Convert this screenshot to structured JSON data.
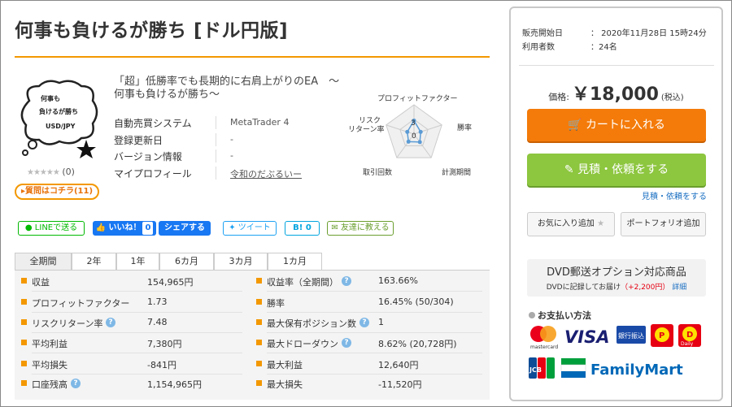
{
  "product": {
    "title": "何事も負けるが勝ち [ドル円版]",
    "cloud_lines": [
      "何事も",
      "負けるが勝ち",
      "USD/JPY"
    ],
    "rating_stars": "★★★★★",
    "rating_count": "(0)",
    "qa_button": "▸質問はコチラ(11)",
    "description": "「超」低勝率でも長期的に右肩上がりのEA　～何事も負けるが勝ち～",
    "properties": [
      {
        "label": "自動売買システム",
        "value": "MetaTrader 4"
      },
      {
        "label": "登録更新日",
        "value": "-"
      },
      {
        "label": "バージョン情報",
        "value": "-"
      },
      {
        "label": "マイプロフィール",
        "value": "令和のだぶるいー"
      }
    ]
  },
  "radar": {
    "labels": [
      "プロフィットファクター",
      "勝率",
      "計測期間",
      "取引回数",
      "リスクリターン率"
    ],
    "scale_labels": [
      "3",
      "0"
    ],
    "values": [
      2.3,
      1.2,
      1.7,
      1.6,
      1.2
    ],
    "max": 5
  },
  "social": {
    "line": "LINEで送る",
    "like": "いいね！",
    "like_count": "0",
    "share": "シェアする",
    "tweet": "ツイート",
    "hatena": "B!",
    "hatena_count": "0",
    "friend": "友達に教える"
  },
  "tabs": [
    "全期間",
    "2年",
    "1年",
    "6カ月",
    "3カ月",
    "1カ月"
  ],
  "stats_left": [
    {
      "label": "収益",
      "value": "154,965円",
      "help": false
    },
    {
      "label": "プロフィットファクター",
      "value": "1.73",
      "help": false
    },
    {
      "label": "リスクリターン率",
      "value": "7.48",
      "help": true
    },
    {
      "label": "平均利益",
      "value": "7,380円",
      "help": false
    },
    {
      "label": "平均損失",
      "value": "-841円",
      "help": false
    },
    {
      "label": "口座残高",
      "value": "1,154,965円",
      "help": true
    }
  ],
  "stats_right": [
    {
      "label": "収益率（全期間）",
      "value": "163.66%",
      "help": true
    },
    {
      "label": "勝率",
      "value": "16.45% (50/304)",
      "help": false
    },
    {
      "label": "最大保有ポジション数",
      "value": "1",
      "help": true
    },
    {
      "label": "最大ドローダウン",
      "value": "8.62% (20,728円)",
      "help": true
    },
    {
      "label": "最大利益",
      "value": "12,640円",
      "help": false
    },
    {
      "label": "最大損失",
      "value": "-11,520円",
      "help": false
    }
  ],
  "sidebar": {
    "sale_start_label": "販売開始日",
    "sale_start_value": "：  2020年11月28日 15時24分",
    "users_label": "利用者数",
    "users_value": "：24名",
    "price_label": "価格:",
    "price_value": "￥18,000",
    "price_tax": "(税込)",
    "cart_button": "カートに入れる",
    "quote_button": "見積・依頼をする",
    "quote_link": "見積・依頼をする",
    "fav_button": "お気に入り追加",
    "portfolio_button": "ポートフォリオ追加",
    "dvd_title": "DVD郵送オプション対応商品",
    "dvd_text": "DVDに記録してお届け",
    "dvd_price": "（+2,200円）",
    "dvd_link": "詳細",
    "payment_title": "お支払い方法",
    "payments_row1": [
      "mastercard",
      "VISA",
      "銀行振込",
      "Pay",
      "Daily"
    ],
    "payments_row2": [
      "JCB",
      "FamilyMart"
    ]
  },
  "colors": {
    "accent_orange": "#f39800",
    "cart_orange": "#f47b0a",
    "quote_green": "#8dc63f",
    "link_blue": "#1a6fc2",
    "facebook_blue": "#1877f2"
  }
}
